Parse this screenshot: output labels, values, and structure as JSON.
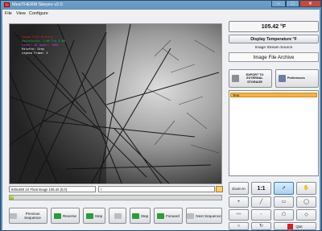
{
  "window": {
    "title": "MexiTHERM Skeyes v2.0",
    "min_glyph": "–",
    "max_glyph": "□",
    "close_glyph": "✕"
  },
  "menu": [
    "File",
    "View",
    "Configure"
  ],
  "image": {
    "overlay": [
      {
        "text": "Image File Archive",
        "color": "#e02020"
      },
      {
        "text": "Emissivity: 1.00  Tra 1.00",
        "color": "#20c040"
      },
      {
        "text": "Lower: 10  Upper: 1000",
        "color": "#c040e0"
      },
      {
        "text": "Palette: Gray",
        "color": "#ffffff"
      },
      {
        "text": "Legend Frame: 3",
        "color": "#ffffff"
      }
    ]
  },
  "status": {
    "image_info": "640x480 1X Float image 105.42   (0,0)",
    "path_prefix": "\\",
    "progress_fraction": 0.02
  },
  "nav": {
    "previous": "Previous Sequence",
    "reverse": "Reverse",
    "step_back": "Step",
    "step_fwd": "Step",
    "forward": "Forward",
    "next": "Next Sequence"
  },
  "panel": {
    "temperature": "105.42 °F",
    "display_temperature": "Display Temperature °F",
    "source_label": "Image Stream Source",
    "source_value": "Image File Archive",
    "export_label": "EXPORT TO EXTERNAL STORAGE",
    "preferences_label": "Preferences",
    "list_items": [
      "Test"
    ]
  },
  "tools": {
    "zoom_in": "Zoom In",
    "one_to_one": "1:1",
    "quit": "Quit"
  }
}
